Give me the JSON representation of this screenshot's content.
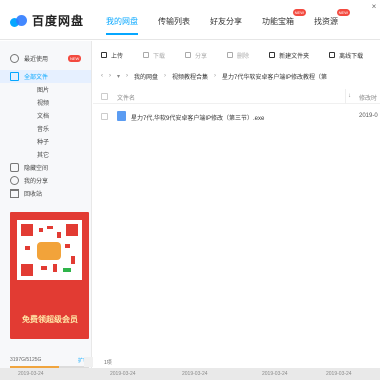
{
  "app": {
    "title": "百度网盘"
  },
  "nav": [
    {
      "label": "我的网盘",
      "active": true,
      "badge": ""
    },
    {
      "label": "传输列表",
      "active": false,
      "badge": ""
    },
    {
      "label": "好友分享",
      "active": false,
      "badge": ""
    },
    {
      "label": "功能宝箱",
      "active": false,
      "badge": "NEW"
    },
    {
      "label": "找资源",
      "active": false,
      "badge": "NEW"
    }
  ],
  "sidebar": {
    "items": [
      {
        "label": "最近使用",
        "badge": "NEW"
      },
      {
        "label": "全部文件"
      },
      {
        "label": "图片"
      },
      {
        "label": "视频"
      },
      {
        "label": "文档"
      },
      {
        "label": "音乐"
      },
      {
        "label": "种子"
      },
      {
        "label": "其它"
      },
      {
        "label": "隐藏空间"
      },
      {
        "label": "我的分享"
      },
      {
        "label": "回收站"
      }
    ],
    "promo_text": "免费领超级会员",
    "storage_text": "3197G/5125G",
    "expand_label": "扩容",
    "storage_fraction": 0.62
  },
  "toolbar": {
    "upload": "上传",
    "download": "下载",
    "share": "分享",
    "delete": "删除",
    "new_folder": "新建文件夹",
    "offline": "离线下载"
  },
  "breadcrumb": {
    "items": [
      "我的网盘",
      "视频教程合集",
      "星力7代华软安卓客户端IP修改教程（第"
    ]
  },
  "columns": {
    "name": "文件名",
    "time": "修改时"
  },
  "files": [
    {
      "name": "星力7代,华软9代安卓客户端IP修改（第三节）.exe",
      "time": "2019-0"
    }
  ],
  "status": {
    "count": "1项"
  },
  "bottom_strip": [
    "2019-03-24",
    "2019-03-24",
    "2019-03-24",
    "2019-03-24",
    "2019-03-24"
  ],
  "colors": {
    "accent": "#06a7ff",
    "badge": "#f34a3f",
    "promo": "#e23b33"
  }
}
